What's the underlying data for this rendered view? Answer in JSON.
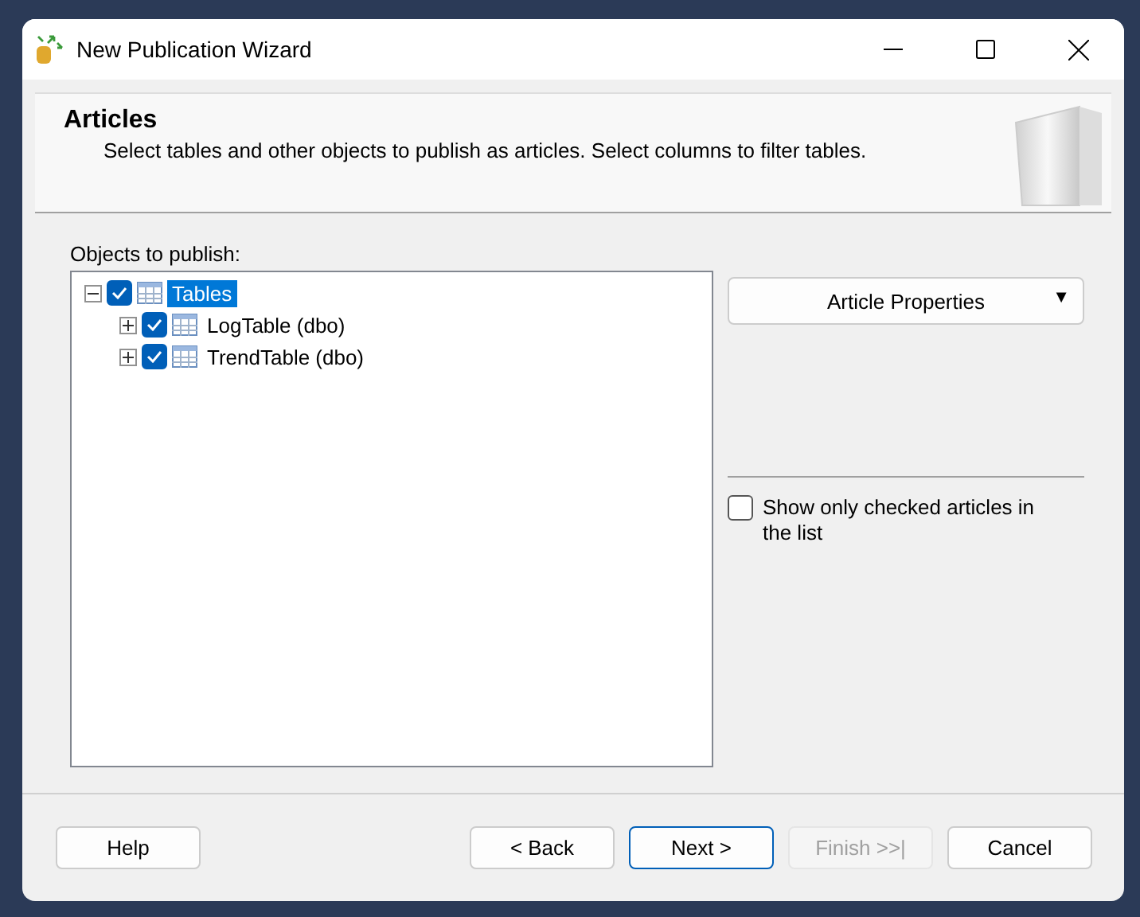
{
  "window": {
    "title": "New Publication Wizard"
  },
  "header": {
    "title": "Articles",
    "description": "Select tables and other objects to publish as articles. Select columns to filter tables."
  },
  "objects_label": "Objects to publish:",
  "tree": [
    {
      "label": "Tables",
      "checked": true,
      "expanded": true,
      "selected": true,
      "children": [
        {
          "label": "LogTable (dbo)",
          "checked": true,
          "expanded": false,
          "selected": false
        },
        {
          "label": "TrendTable (dbo)",
          "checked": true,
          "expanded": false,
          "selected": false
        }
      ]
    }
  ],
  "article_properties": {
    "label": "Article Properties",
    "caret": "▼"
  },
  "show_only_checked": {
    "label": "Show only checked articles in the list",
    "checked": false
  },
  "help_button": {
    "label": "Help"
  },
  "buttons": [
    {
      "label": "< Back",
      "disabled": false,
      "default": false
    },
    {
      "label": "Next >",
      "disabled": false,
      "default": true
    },
    {
      "label": "Finish >>|",
      "disabled": true,
      "default": false
    },
    {
      "label": "Cancel",
      "disabled": false,
      "default": false
    }
  ]
}
